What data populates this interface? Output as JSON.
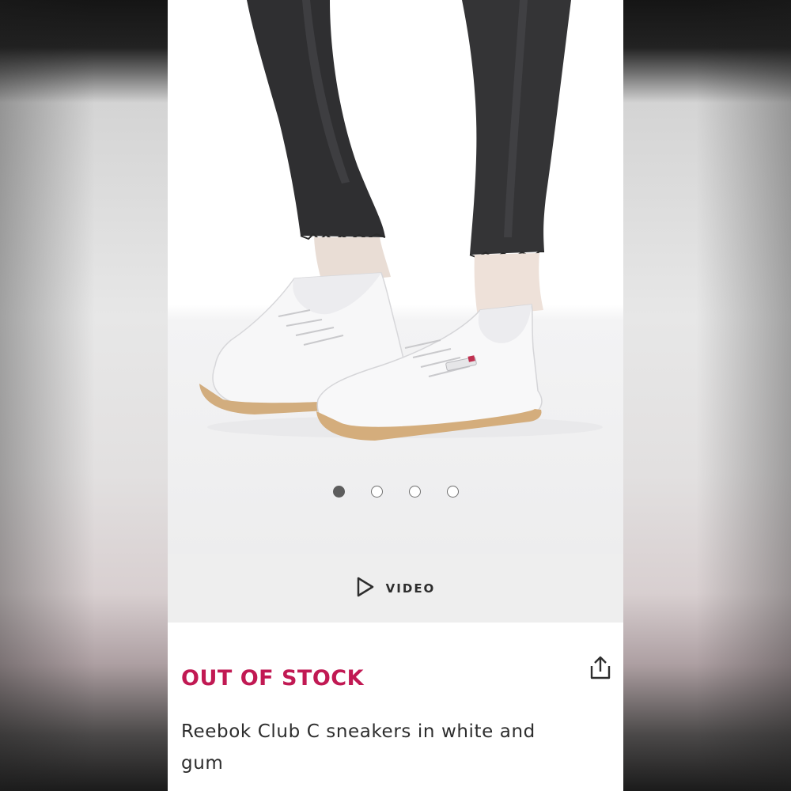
{
  "gallery": {
    "image_subject": "White Reebok Club C sneakers worn with black raw-hem skinny jeans",
    "slide_count": 4,
    "active_slide": 1
  },
  "video": {
    "label": "VIDEO",
    "icon": "play-icon"
  },
  "product": {
    "stock_status": "OUT OF STOCK",
    "name": "Reebok Club C sneakers in white and gum",
    "share_icon": "share-icon"
  },
  "colors": {
    "stock_status": "#c11953",
    "text": "#2d2d2d",
    "video_bar_bg": "#eeeeee"
  }
}
